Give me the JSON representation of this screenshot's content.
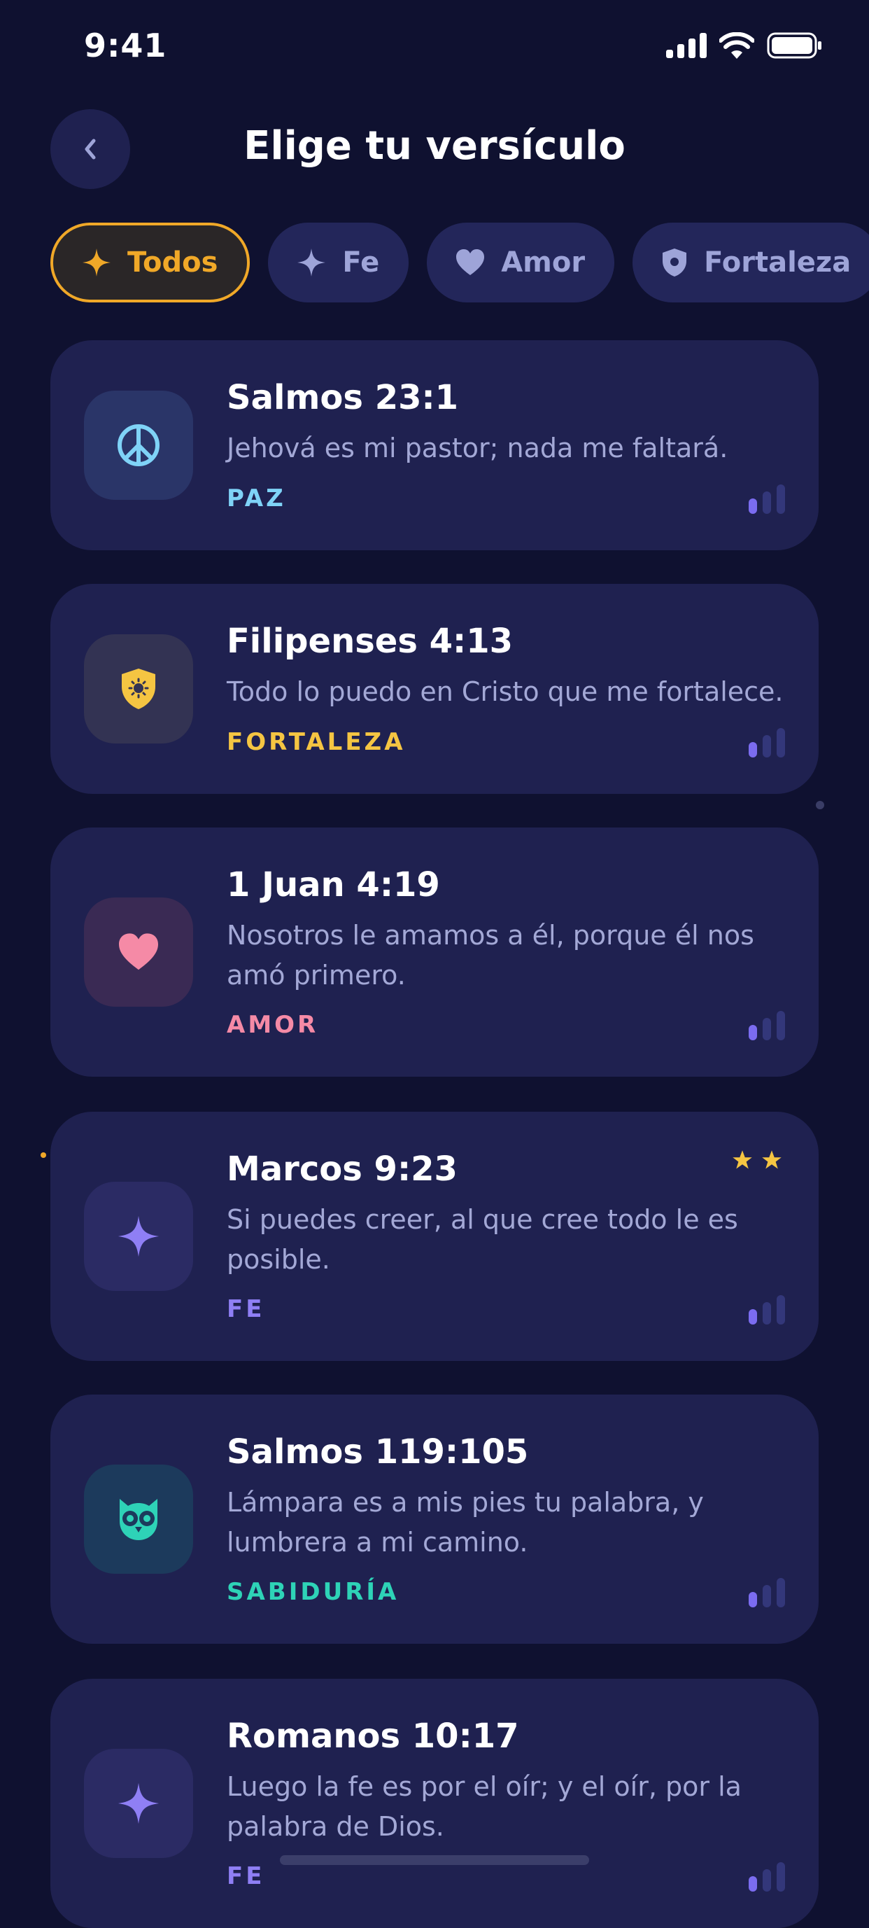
{
  "status_bar": {
    "time": "9:41"
  },
  "header": {
    "title": "Elige tu versículo"
  },
  "filters": [
    {
      "label": "Todos",
      "icon": "sparkle-icon",
      "active": true
    },
    {
      "label": "Fe",
      "icon": "sparkle-icon",
      "active": false
    },
    {
      "label": "Amor",
      "icon": "heart-icon",
      "active": false
    },
    {
      "label": "Fortaleza",
      "icon": "shield-icon",
      "active": false
    }
  ],
  "verses": [
    {
      "reference": "Salmos 23:1",
      "text": "Jehová es mi pastor; nada me faltará.",
      "tag": "PAZ",
      "icon": "peace-icon",
      "tag_color": "#7fd3f7"
    },
    {
      "reference": "Filipenses 4:13",
      "text": "Todo lo puedo en Cristo que me fortalece.",
      "tag": "FORTALEZA",
      "icon": "shield-icon",
      "tag_color": "#f5c542"
    },
    {
      "reference": "1 Juan 4:19",
      "text": "Nosotros le amamos a él, porque él nos amó primero.",
      "tag": "AMOR",
      "icon": "heart-icon",
      "tag_color": "#f58aa6"
    },
    {
      "reference": "Marcos 9:23",
      "text": "Si puedes creer, al que cree todo le es posible.",
      "tag": "FE",
      "icon": "sparkle-icon",
      "tag_color": "#8f7ff5",
      "stars": 2
    },
    {
      "reference": "Salmos 119:105",
      "text": "Lámpara es a mis pies tu palabra, y lumbrera a mi camino.",
      "tag": "SABIDURÍA",
      "icon": "owl-icon",
      "tag_color": "#2ed3b7"
    },
    {
      "reference": "Romanos 10:17",
      "text": "Luego la fe es por el oír; y el oír, por la palabra de Dios.",
      "tag": "FE",
      "icon": "sparkle-icon",
      "tag_color": "#8f7ff5"
    }
  ],
  "colors": {
    "background": "#0f1130",
    "card": "#1f2150",
    "accent": "#f0a828"
  }
}
